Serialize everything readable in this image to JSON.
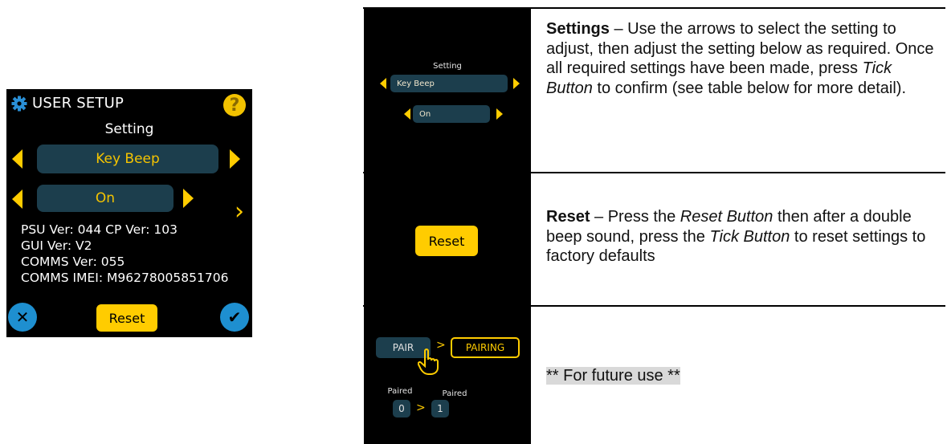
{
  "device": {
    "title": "USER SETUP",
    "help_symbol": "?",
    "setting_label": "Setting",
    "setting_value": "Key Beep",
    "option_value": "On",
    "info_lines": [
      "PSU Ver: 044    CP Ver: 103",
      "GUI Ver: V2",
      "COMMS Ver: 055",
      "COMMS IMEI: M96278005851706"
    ],
    "reset_label": "Reset",
    "cancel_symbol": "✕",
    "confirm_symbol": "✔",
    "icons": [
      "gear-icon",
      "help-icon",
      "arrow-left-icon",
      "arrow-right-icon",
      "chevron-right-icon",
      "cancel-icon",
      "tick-icon"
    ],
    "accent": "#ffcc00",
    "pill_color": "#1c3e4d",
    "button_blue": "#1e8fd0"
  },
  "table": {
    "rows": [
      {
        "mini": {
          "label": "Setting",
          "setting_value": "Key Beep",
          "option_value": "On"
        },
        "title": "Settings",
        "text_a": " – Use the arrows to select the setting to adjust, then adjust the setting below as required. Once all required settings have been made, press ",
        "em_a": "Tick Button",
        "text_b": " to confirm (see table below for more detail)."
      },
      {
        "mini": {
          "reset_label": "Reset"
        },
        "title": "Reset",
        "text_a": " – Press the ",
        "em_a": "Reset Button",
        "text_b": " then after a double beep sound, press the ",
        "em_b": "Tick Button",
        "text_c": " to reset settings to factory defaults"
      },
      {
        "mini": {
          "pair_label": "PAIR",
          "pairing_label": "PAIRING",
          "paired_label_a": "Paired",
          "paired_label_b": "Paired",
          "paired_value_a": "0",
          "paired_value_b": "1"
        },
        "note": "** For future use **"
      }
    ]
  }
}
